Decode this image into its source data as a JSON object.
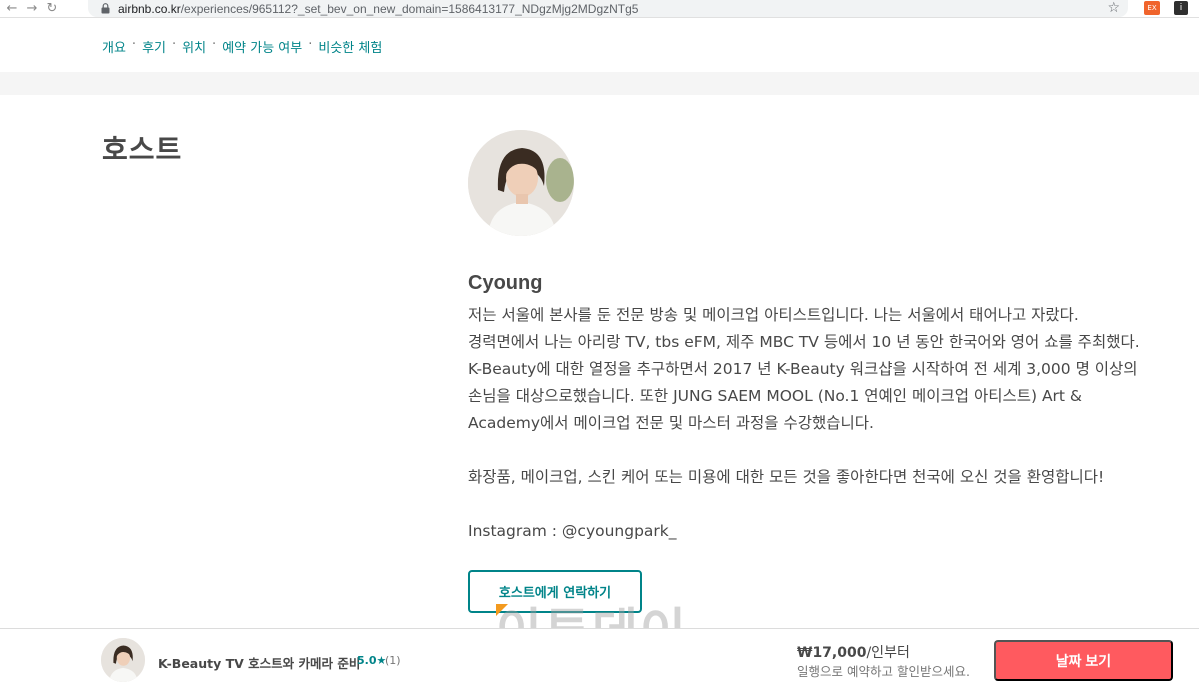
{
  "browser": {
    "url_domain": "airbnb.co.kr",
    "url_path": "/experiences/965112?_set_bev_on_new_domain=1586413177_NDgzMjg2MDgzNTg5",
    "extension_1_label": "EX",
    "extension_2_label": "i"
  },
  "subnav": {
    "items": [
      "개요",
      "후기",
      "위치",
      "예약 가능 여부",
      "비슷한 체험"
    ],
    "separator": "·"
  },
  "host": {
    "heading": "호스트",
    "name": "Cyoung",
    "bio_lines": [
      "저는 서울에 본사를 둔 전문 방송 및 메이크업 아티스트입니다. 나는 서울에서 태어나고 자랐다.",
      "경력면에서 나는 아리랑 TV, tbs eFM, 제주 MBC TV 등에서 10 년 동안 한국어와 영어 쇼를 주최했다.",
      "K-Beauty에 대한 열정을 추구하면서 2017 년 K-Beauty 워크샵을 시작하여 전 세계 3,000 명 이상의",
      "손님을 대상으로했습니다. 또한 JUNG SAEM MOOL (No.1 연예인 메이크업 아티스트) Art &",
      "Academy에서 메이크업 전문 및 마스터 과정을 수강했습니다."
    ],
    "bio_para_2": "화장품, 메이크업, 스킨 케어 또는 미용에 대한 모든 것을 좋아한다면 천국에 오신 것을 환영합니다!",
    "instagram": "Instagram : @cyoungpark_",
    "contact_button": "호스트에게 연락하기"
  },
  "watermark": "이투데이",
  "booking_bar": {
    "title": "K-Beauty TV 호스트와 카메라 준비",
    "rating": "5.0★",
    "review_count": "(1)",
    "price": "₩17,000",
    "price_unit": "/인부터",
    "note": "일행으로 예약하고 할인받으세요.",
    "date_button": "날짜 보기"
  },
  "colors": {
    "teal": "#008489",
    "coral": "#ff5a5f",
    "text": "#484848"
  }
}
